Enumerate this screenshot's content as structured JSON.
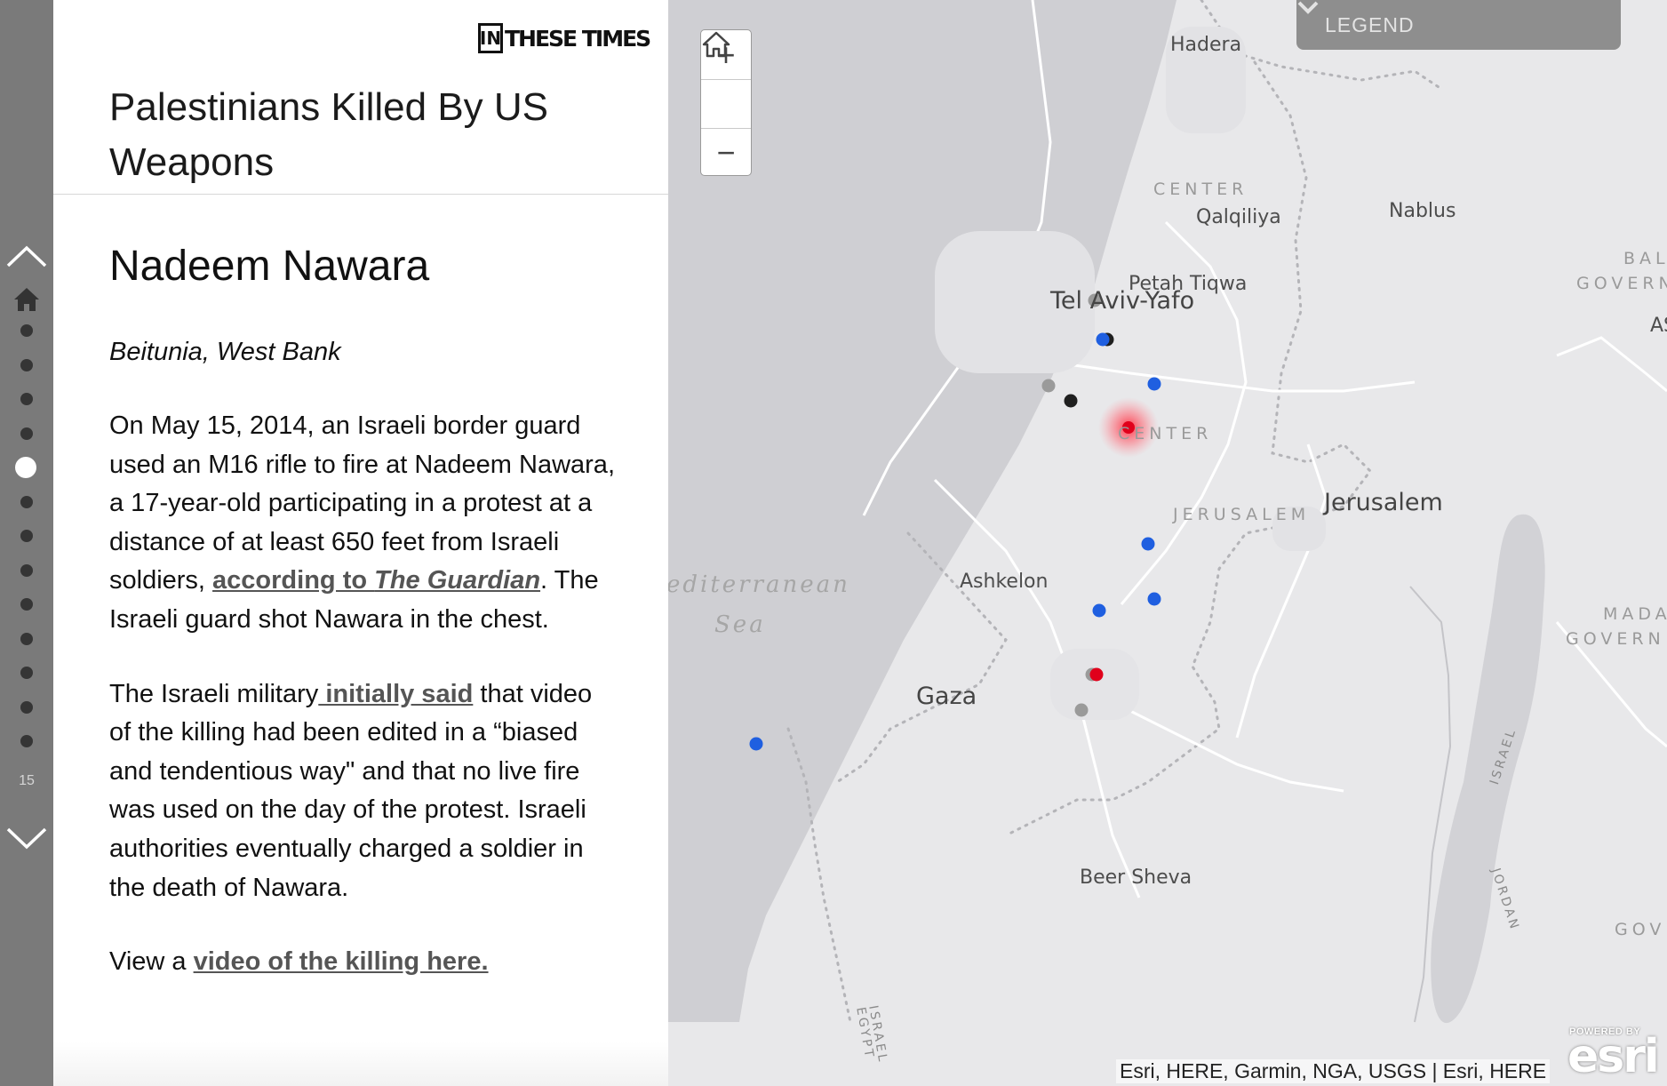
{
  "story": {
    "publication": "THESE TIMES",
    "title": "Palestinians Killed By US Weapons"
  },
  "navigation": {
    "up_icon": "chevron-up-icon",
    "home_icon": "home-icon",
    "down_icon": "chevron-down-icon",
    "dot_count": 13,
    "active_index": 4,
    "entry_count": "15"
  },
  "entry": {
    "name": "Nadeem Nawara",
    "location": "Beitunia, West Bank",
    "p1_pre": "On May 15, 2014, an Israeli border guard used an M16 rifle to fire at Nadeem Nawara, a 17-year-old participating in a protest at a distance of at least 650 feet from Israeli soldiers, ",
    "p1_link": "according to ",
    "p1_link_em": "The Guardian",
    "p1_post": ". The Israeli guard shot Nawara in the chest.",
    "p2_pre": "The Israeli military",
    "p2_link": " initially said",
    "p2_post": " that video of the killing had been edited in a “biased and tendentious way\" and that no live fire was used on the day of the protest. Israeli authorities eventually charged a soldier in the death of Nawara.",
    "p3_pre": "View a ",
    "p3_link": "video of the killing here."
  },
  "map": {
    "zoom_in_label": "+",
    "zoom_out_label": "−",
    "home_icon": "home-icon",
    "legend_label": "LEGEND",
    "legend_icon": "chevron-down-icon",
    "labels": {
      "hadera": "Hadera",
      "center_n": "CENTER",
      "qalqiliya": "Qalqiliya",
      "nablus": "Nablus",
      "petah_tiqwa": "Petah Tiqwa",
      "tel_aviv": "Tel Aviv-Yafo",
      "center_s": "CENTER",
      "jerusalem_region": "JERUSALEM",
      "jerusalem": "Jerusalem",
      "ashkelon": "Ashkelon",
      "sea_line1": "editerranean",
      "sea_line2": "Sea",
      "gaza": "Gaza",
      "beer_sheva": "Beer Sheva",
      "bal": "BAL",
      "govern": "GOVERN",
      "as": "AS",
      "mada": "MADA",
      "govern2": "GOVERN",
      "gov": "GOV",
      "israel_border_top": "ISRAEL",
      "jordan_border": "JORDAN",
      "israel_border_bottom": "ISRAEL",
      "egypt_border": "EGYPT"
    },
    "markers": [
      {
        "color": "#9a9a9a",
        "kind": "gray"
      },
      {
        "color": "#1f1f1f",
        "kind": "black"
      },
      {
        "color": "#1f5fe0",
        "kind": "blue"
      },
      {
        "color": "#9a9a9a",
        "kind": "gray"
      },
      {
        "color": "#1f1f1f",
        "kind": "black"
      },
      {
        "color": "#1f5fe0",
        "kind": "blue"
      },
      {
        "color": "#e0001b",
        "kind": "selected"
      },
      {
        "color": "#1f5fe0",
        "kind": "blue"
      },
      {
        "color": "#1f5fe0",
        "kind": "blue"
      },
      {
        "color": "#1f5fe0",
        "kind": "blue"
      },
      {
        "color": "#9a9a9a",
        "kind": "gray"
      },
      {
        "color": "#e0001b",
        "kind": "red"
      },
      {
        "color": "#9a9a9a",
        "kind": "gray"
      },
      {
        "color": "#1f5fe0",
        "kind": "blue"
      }
    ],
    "attribution": "Esri, HERE, Garmin, NGA, USGS | Esri, HERE",
    "esri_powered": "POWERED BY",
    "esri_logo": "esri"
  },
  "colors": {
    "sea": "#cfcfd3",
    "land": "#ececee",
    "selected_marker": "#e0001b",
    "blue_marker": "#1f5fe0",
    "gray_marker": "#9a9a9a",
    "black_marker": "#1f1f1f",
    "nav_rail": "#7a7a7a",
    "legend_bg": "#8e8e8e"
  }
}
